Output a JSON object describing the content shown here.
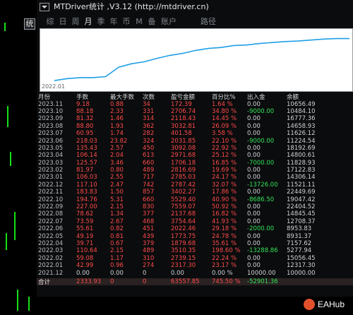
{
  "window": {
    "title": "MTDriver统计 ,V3.12 (http://mtdriver.cn)",
    "side_button": "统"
  },
  "tabs": [
    {
      "label": "综",
      "active": false
    },
    {
      "label": "日",
      "active": false
    },
    {
      "label": "周",
      "active": false
    },
    {
      "label": "月",
      "active": true
    },
    {
      "label": "季",
      "active": false
    },
    {
      "label": "年",
      "active": false
    },
    {
      "label": "币",
      "active": false
    },
    {
      "label": "M",
      "active": false
    },
    {
      "label": "备",
      "active": false
    },
    {
      "label": "账户",
      "active": false
    },
    {
      "label": "路径",
      "active": false
    }
  ],
  "equity_chart": {
    "start_label": "2022.01",
    "line_color": "#1f9fe6",
    "points_norm": [
      0.07,
      0.11,
      0.13,
      0.13,
      0.15,
      0.34,
      0.41,
      0.45,
      0.52,
      0.58,
      0.62,
      0.68,
      0.72,
      0.74,
      0.78,
      0.79,
      0.82,
      0.84,
      0.86,
      0.87,
      0.89,
      0.91,
      0.92,
      0.92
    ]
  },
  "table": {
    "headers": [
      "月份",
      "手数",
      "最大手数",
      "次数",
      "盈亏金额",
      "百分比%",
      "出入金",
      "余额"
    ],
    "rows": [
      [
        "2023.11",
        "9.18",
        "0.88",
        "34",
        "172.39",
        "1.64 %",
        "0.00",
        "10656.49"
      ],
      [
        "2023.10",
        "88.18",
        "2.33",
        "331",
        "2706.74",
        "34.80 %",
        "-9000.00",
        "10484.10"
      ],
      [
        "2023.09",
        "81.32",
        "1.46",
        "314",
        "2118.43",
        "14.45 %",
        "0.00",
        "16777.36"
      ],
      [
        "2023.08",
        "88.80",
        "1.93",
        "362",
        "3032.81",
        "26.09 %",
        "0.00",
        "14658.93"
      ],
      [
        "2023.07",
        "60.95",
        "1.74",
        "282",
        "401.58",
        "3.58 %",
        "0.00",
        "11626.12"
      ],
      [
        "2023.06",
        "218.03",
        "23.82",
        "324",
        "2031.85",
        "22.10 %",
        "-9000.00",
        "11224.54"
      ],
      [
        "2023.05",
        "135.43",
        "2.57",
        "450",
        "3092.08",
        "22.92 %",
        "0.00",
        "18192.69"
      ],
      [
        "2023.04",
        "106.14",
        "2.04",
        "613",
        "2971.68",
        "25.12 %",
        "0.00",
        "14800.61"
      ],
      [
        "2023.03",
        "125.57",
        "3.46",
        "660",
        "1706.18",
        "16.85 %",
        "-7000.00",
        "11828.93"
      ],
      [
        "2023.02",
        "81.97",
        "0.80",
        "489",
        "2816.69",
        "19.69 %",
        "0.00",
        "17122.83"
      ],
      [
        "2023.01",
        "106.03",
        "2.55",
        "717",
        "2785.03",
        "24.17 %",
        "0.00",
        "14306.14"
      ],
      [
        "2022.12",
        "117.10",
        "2.47",
        "742",
        "2787.42",
        "32.07 %",
        "-13726.00",
        "11521.11"
      ],
      [
        "2022.11",
        "183.83",
        "1.50",
        "857",
        "3402.27",
        "17.86 %",
        "0.00",
        "22449.69"
      ],
      [
        "2022.10",
        "194.76",
        "5.31",
        "660",
        "5529.40",
        "40.90 %",
        "-8686.50",
        "19047.42"
      ],
      [
        "2022.09",
        "227.00",
        "2.15",
        "830",
        "7559.07",
        "50.92 %",
        "0.00",
        "22404.52"
      ],
      [
        "2022.08",
        "78.62",
        "1.34",
        "377",
        "2137.68",
        "16.82 %",
        "0.00",
        "14845.45"
      ],
      [
        "2022.07",
        "73.59",
        "2.67",
        "468",
        "3754.64",
        "41.93 %",
        "0.00",
        "12708.37"
      ],
      [
        "2022.06",
        "55.61",
        "0.82",
        "451",
        "2022.46",
        "29.18 %",
        "-2000.00",
        "8953.83"
      ],
      [
        "2022.05",
        "49.19",
        "0.81",
        "439",
        "1773.75",
        "24.78 %",
        "0.00",
        "8931.37"
      ],
      [
        "2022.04",
        "39.71",
        "0.67",
        "379",
        "1879.68",
        "35.61 %",
        "0.00",
        "7157.62"
      ],
      [
        "2022.03",
        "110.64",
        "2.15",
        "489",
        "3510.35",
        "198.60 %",
        "-13288.86",
        "5277.94"
      ],
      [
        "2022.02",
        "59.08",
        "1.17",
        "310",
        "2739.15",
        "22.24 %",
        "0.00",
        "15056.45"
      ],
      [
        "2022.01",
        "42.99",
        "0.96",
        "274",
        "2317.30",
        "23.17 %",
        "0.00",
        "12317.30"
      ],
      [
        "2021.12",
        "0.00",
        "0.00",
        "0",
        "0.00",
        "0.00 %",
        "10000.00",
        "10000.00"
      ]
    ],
    "total": [
      "合计",
      "2333.93",
      "0",
      "0",
      "63557.85",
      "745.50 %",
      "-52901.36",
      ""
    ]
  },
  "watermark": {
    "text": "EAHub"
  },
  "colors": {
    "red": "#ff4b4b",
    "green": "#33e35a",
    "text": "#cfd3d8"
  }
}
